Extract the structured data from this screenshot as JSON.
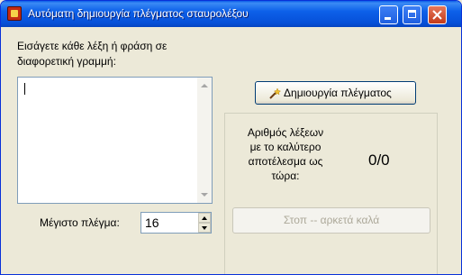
{
  "window": {
    "title": "Αυτόματη δημιουργία πλέγματος σταυρολέξου",
    "app_icon": "crossword-app-icon",
    "controls": [
      "minimize",
      "maximize",
      "close"
    ]
  },
  "instructions": {
    "line1": "Εισάγετε κάθε λέξη ή φράση σε",
    "line2": "διαφορετική γραμμή:"
  },
  "words_input": {
    "value": ""
  },
  "max_grid": {
    "label": "Μέγιστο πλέγμα:",
    "value": "16"
  },
  "create_button": {
    "label": "Δημιουργία πλέγματος",
    "icon": "magic-wand-icon"
  },
  "result": {
    "label_line1": "Αριθμός λέξεων",
    "label_line2": "με το καλύτερο",
    "label_line3": "αποτέλεσμα ως",
    "label_line4": "τώρα:",
    "value": "0/0"
  },
  "stop_button": {
    "label": "Στοπ -- αρκετά καλά",
    "enabled": false
  }
}
